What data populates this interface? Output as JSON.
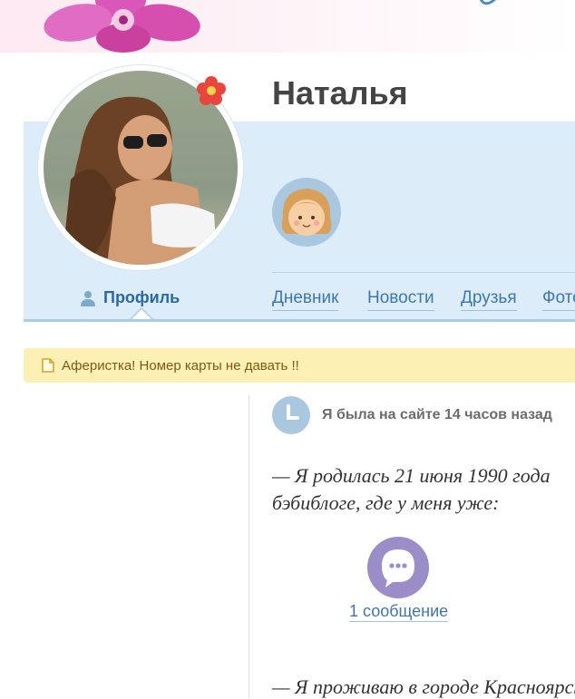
{
  "profile": {
    "name": "Наталья"
  },
  "nav": {
    "active_tab": "Профиль",
    "tabs": [
      "Дневник",
      "Новости",
      "Друзья",
      "Фото"
    ]
  },
  "warning": {
    "text": "Аферистка! Номер карты не давать !!"
  },
  "status": {
    "last_seen": "Я была на сайте 14 часов назад"
  },
  "about": {
    "line1": "— Я родилась 21 июня 1990 года",
    "line2": "бэбиблоге, где у меня уже:",
    "messages": "1 сообщение",
    "line3": "— Я проживаю в городе Красноярск"
  },
  "colors": {
    "panel_bg": "#dcecf8",
    "link": "#3f78a8",
    "warning_bg": "#fdf0b4",
    "message_icon": "#9b8dc8"
  },
  "icons": {
    "banner": "pink-flower-icon",
    "avatar_badge": "red-flower-icon",
    "kid": "girl-face-icon",
    "profile_tab": "user-icon",
    "warning": "note-icon",
    "status": "clock-icon",
    "messages": "speech-bubble-icon"
  }
}
